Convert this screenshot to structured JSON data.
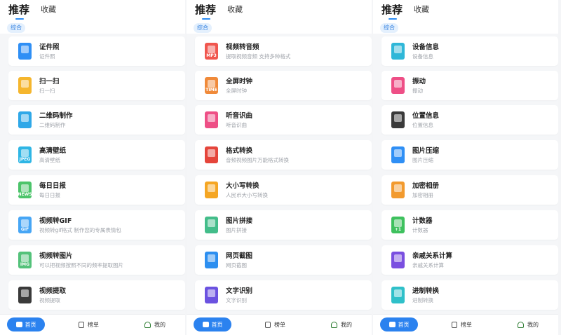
{
  "tabs": {
    "recommend": "推荐",
    "favorites": "收藏"
  },
  "chip": "综合",
  "nav": {
    "home": "首页",
    "ranking": "榜单",
    "mine": "我的"
  },
  "colors": {
    "accent": "#2b82ef"
  },
  "panels": [
    {
      "items": [
        {
          "title": "证件照",
          "subtitle": "证件照",
          "icon": "id-photo-icon",
          "color": "#2f8ff5",
          "badge": ""
        },
        {
          "title": "扫一扫",
          "subtitle": "扫一扫",
          "icon": "scan-icon",
          "color": "#f5b62e",
          "badge": ""
        },
        {
          "title": "二维码制作",
          "subtitle": "二维码制作",
          "icon": "qrcode-icon",
          "color": "#2fa8e8",
          "badge": ""
        },
        {
          "title": "高清壁纸",
          "subtitle": "高清壁纸",
          "icon": "wallpaper-icon",
          "color": "#2fb6e5",
          "badge": "JPEG"
        },
        {
          "title": "每日日报",
          "subtitle": "每日日报",
          "icon": "daily-news-icon",
          "color": "#4cc46a",
          "badge": "NEWS"
        },
        {
          "title": "视频转GIF",
          "subtitle": "视频转gif格式 制作您的专属表情包",
          "icon": "gif-icon",
          "color": "#47a6f5",
          "badge": "GIF"
        },
        {
          "title": "视频转图片",
          "subtitle": "可以把视频按照不同的频率提取图片",
          "icon": "video-to-image-icon",
          "color": "#54c27a",
          "badge": "IMG"
        },
        {
          "title": "视频提取",
          "subtitle": "视频提取",
          "icon": "video-extract-icon",
          "color": "#3a3a3a",
          "badge": ""
        }
      ]
    },
    {
      "items": [
        {
          "title": "视频转音频",
          "subtitle": "提取视频音频 支持多种格式",
          "icon": "mp3-icon",
          "color": "#f0564e",
          "badge": "MP3"
        },
        {
          "title": "全屏时钟",
          "subtitle": "全屏时钟",
          "icon": "clock-icon",
          "color": "#f08a3a",
          "badge": "TIME"
        },
        {
          "title": "听音识曲",
          "subtitle": "听音识曲",
          "icon": "music-icon",
          "color": "#ee4f86",
          "badge": ""
        },
        {
          "title": "格式转换",
          "subtitle": "音频视频图片万能格式转换",
          "icon": "convert-icon",
          "color": "#e5453b",
          "badge": ""
        },
        {
          "title": "大小写转换",
          "subtitle": "人民币大小写转换",
          "icon": "case-convert-icon",
          "color": "#f5a623",
          "badge": ""
        },
        {
          "title": "图片拼接",
          "subtitle": "图片拼接",
          "icon": "image-stitch-icon",
          "color": "#43bd8a",
          "badge": ""
        },
        {
          "title": "网页截图",
          "subtitle": "网页截图",
          "icon": "web-screenshot-icon",
          "color": "#2d8ff0",
          "badge": ""
        },
        {
          "title": "文字识别",
          "subtitle": "文字识别",
          "icon": "ocr-icon",
          "color": "#6b52e0",
          "badge": ""
        }
      ]
    },
    {
      "items": [
        {
          "title": "设备信息",
          "subtitle": "设备信息",
          "icon": "device-info-icon",
          "color": "#2fb7d8",
          "badge": ""
        },
        {
          "title": "振动",
          "subtitle": "振动",
          "icon": "vibrate-icon",
          "color": "#ee4f86",
          "badge": ""
        },
        {
          "title": "位置信息",
          "subtitle": "位置信息",
          "icon": "location-icon",
          "color": "#3a3a3a",
          "badge": ""
        },
        {
          "title": "图片压缩",
          "subtitle": "图片压缩",
          "icon": "image-compress-icon",
          "color": "#2f8ff5",
          "badge": ""
        },
        {
          "title": "加密相册",
          "subtitle": "加密相册",
          "icon": "encrypted-album-icon",
          "color": "#f29a2e",
          "badge": ""
        },
        {
          "title": "计数器",
          "subtitle": "计数器",
          "icon": "counter-icon",
          "color": "#3ec15e",
          "badge": "+1"
        },
        {
          "title": "亲戚关系计算",
          "subtitle": "亲戚关系计算",
          "icon": "relatives-icon",
          "color": "#7a4fe0",
          "badge": ""
        },
        {
          "title": "进制转换",
          "subtitle": "进制转换",
          "icon": "base-convert-icon",
          "color": "#2fc0c9",
          "badge": ""
        }
      ]
    }
  ]
}
